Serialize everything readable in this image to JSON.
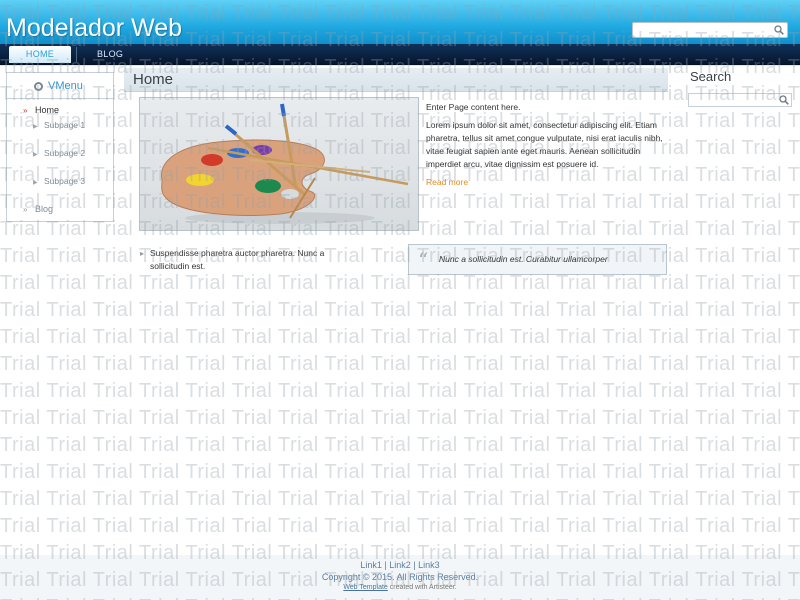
{
  "header": {
    "site_title": "Modelador Web",
    "search_placeholder": ""
  },
  "nav": {
    "items": [
      {
        "label": "HOME",
        "active": true
      },
      {
        "label": "BLOG",
        "active": false
      }
    ]
  },
  "vmenu": {
    "title": "VMenu",
    "items": [
      {
        "label": "Home",
        "active": true
      },
      {
        "label": "Subpage 1"
      },
      {
        "label": "Subpage 2"
      },
      {
        "label": "Subpage 3"
      },
      {
        "label": "Blog"
      }
    ]
  },
  "content": {
    "heading": "Home",
    "intro_title": "Enter Page content here.",
    "intro_body": "Lorem ipsum dolor sit amet, consectetur adipiscing elit. Etiam pharetra, tellus sit amet congue vulputate, nisi erat iaculis nibh, vitae feugiat sapien ante eget mauris. Aenean sollicitudin imperdiet arcu, vitae dignissim est posuere id.",
    "read_more": "Read more",
    "bullet_text": "Suspendisse pharetra auctor pharetra. Nunc a sollicitudin est.",
    "quote_text": "Nunc a sollicitudin est. Curabitur ullamcorper"
  },
  "sidebar": {
    "search_title": "Search",
    "search_placeholder": ""
  },
  "footer": {
    "link1": "Link1",
    "link2": "Link2",
    "link3": "Link3",
    "separator": " | ",
    "copyright": "Copyright © 2015. All Rights Reserved.",
    "credit_link": "Web Template",
    "credit_rest": " created with Artisteer."
  },
  "watermark": {
    "text": "Trial"
  },
  "colors": {
    "header_top": "#5fd0f6",
    "header_bottom": "#0f8fca",
    "nav_bg": "#10315a",
    "accent": "#2a9fd6",
    "read_more": "#e08d1c"
  }
}
